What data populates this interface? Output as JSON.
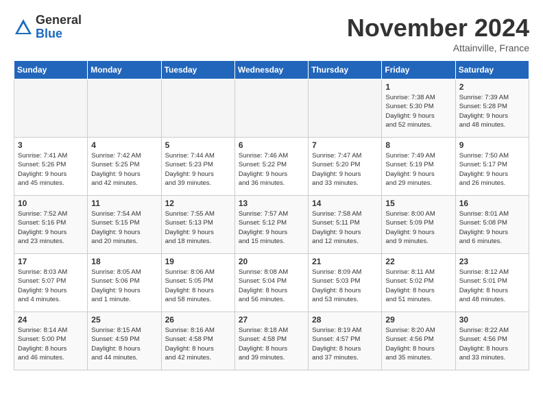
{
  "logo": {
    "general": "General",
    "blue": "Blue"
  },
  "title": "November 2024",
  "location": "Attainville, France",
  "days_of_week": [
    "Sunday",
    "Monday",
    "Tuesday",
    "Wednesday",
    "Thursday",
    "Friday",
    "Saturday"
  ],
  "weeks": [
    [
      {
        "day": "",
        "detail": ""
      },
      {
        "day": "",
        "detail": ""
      },
      {
        "day": "",
        "detail": ""
      },
      {
        "day": "",
        "detail": ""
      },
      {
        "day": "",
        "detail": ""
      },
      {
        "day": "1",
        "detail": "Sunrise: 7:38 AM\nSunset: 5:30 PM\nDaylight: 9 hours\nand 52 minutes."
      },
      {
        "day": "2",
        "detail": "Sunrise: 7:39 AM\nSunset: 5:28 PM\nDaylight: 9 hours\nand 48 minutes."
      }
    ],
    [
      {
        "day": "3",
        "detail": "Sunrise: 7:41 AM\nSunset: 5:26 PM\nDaylight: 9 hours\nand 45 minutes."
      },
      {
        "day": "4",
        "detail": "Sunrise: 7:42 AM\nSunset: 5:25 PM\nDaylight: 9 hours\nand 42 minutes."
      },
      {
        "day": "5",
        "detail": "Sunrise: 7:44 AM\nSunset: 5:23 PM\nDaylight: 9 hours\nand 39 minutes."
      },
      {
        "day": "6",
        "detail": "Sunrise: 7:46 AM\nSunset: 5:22 PM\nDaylight: 9 hours\nand 36 minutes."
      },
      {
        "day": "7",
        "detail": "Sunrise: 7:47 AM\nSunset: 5:20 PM\nDaylight: 9 hours\nand 33 minutes."
      },
      {
        "day": "8",
        "detail": "Sunrise: 7:49 AM\nSunset: 5:19 PM\nDaylight: 9 hours\nand 29 minutes."
      },
      {
        "day": "9",
        "detail": "Sunrise: 7:50 AM\nSunset: 5:17 PM\nDaylight: 9 hours\nand 26 minutes."
      }
    ],
    [
      {
        "day": "10",
        "detail": "Sunrise: 7:52 AM\nSunset: 5:16 PM\nDaylight: 9 hours\nand 23 minutes."
      },
      {
        "day": "11",
        "detail": "Sunrise: 7:54 AM\nSunset: 5:15 PM\nDaylight: 9 hours\nand 20 minutes."
      },
      {
        "day": "12",
        "detail": "Sunrise: 7:55 AM\nSunset: 5:13 PM\nDaylight: 9 hours\nand 18 minutes."
      },
      {
        "day": "13",
        "detail": "Sunrise: 7:57 AM\nSunset: 5:12 PM\nDaylight: 9 hours\nand 15 minutes."
      },
      {
        "day": "14",
        "detail": "Sunrise: 7:58 AM\nSunset: 5:11 PM\nDaylight: 9 hours\nand 12 minutes."
      },
      {
        "day": "15",
        "detail": "Sunrise: 8:00 AM\nSunset: 5:09 PM\nDaylight: 9 hours\nand 9 minutes."
      },
      {
        "day": "16",
        "detail": "Sunrise: 8:01 AM\nSunset: 5:08 PM\nDaylight: 9 hours\nand 6 minutes."
      }
    ],
    [
      {
        "day": "17",
        "detail": "Sunrise: 8:03 AM\nSunset: 5:07 PM\nDaylight: 9 hours\nand 4 minutes."
      },
      {
        "day": "18",
        "detail": "Sunrise: 8:05 AM\nSunset: 5:06 PM\nDaylight: 9 hours\nand 1 minute."
      },
      {
        "day": "19",
        "detail": "Sunrise: 8:06 AM\nSunset: 5:05 PM\nDaylight: 8 hours\nand 58 minutes."
      },
      {
        "day": "20",
        "detail": "Sunrise: 8:08 AM\nSunset: 5:04 PM\nDaylight: 8 hours\nand 56 minutes."
      },
      {
        "day": "21",
        "detail": "Sunrise: 8:09 AM\nSunset: 5:03 PM\nDaylight: 8 hours\nand 53 minutes."
      },
      {
        "day": "22",
        "detail": "Sunrise: 8:11 AM\nSunset: 5:02 PM\nDaylight: 8 hours\nand 51 minutes."
      },
      {
        "day": "23",
        "detail": "Sunrise: 8:12 AM\nSunset: 5:01 PM\nDaylight: 8 hours\nand 48 minutes."
      }
    ],
    [
      {
        "day": "24",
        "detail": "Sunrise: 8:14 AM\nSunset: 5:00 PM\nDaylight: 8 hours\nand 46 minutes."
      },
      {
        "day": "25",
        "detail": "Sunrise: 8:15 AM\nSunset: 4:59 PM\nDaylight: 8 hours\nand 44 minutes."
      },
      {
        "day": "26",
        "detail": "Sunrise: 8:16 AM\nSunset: 4:58 PM\nDaylight: 8 hours\nand 42 minutes."
      },
      {
        "day": "27",
        "detail": "Sunrise: 8:18 AM\nSunset: 4:58 PM\nDaylight: 8 hours\nand 39 minutes."
      },
      {
        "day": "28",
        "detail": "Sunrise: 8:19 AM\nSunset: 4:57 PM\nDaylight: 8 hours\nand 37 minutes."
      },
      {
        "day": "29",
        "detail": "Sunrise: 8:20 AM\nSunset: 4:56 PM\nDaylight: 8 hours\nand 35 minutes."
      },
      {
        "day": "30",
        "detail": "Sunrise: 8:22 AM\nSunset: 4:56 PM\nDaylight: 8 hours\nand 33 minutes."
      }
    ]
  ]
}
